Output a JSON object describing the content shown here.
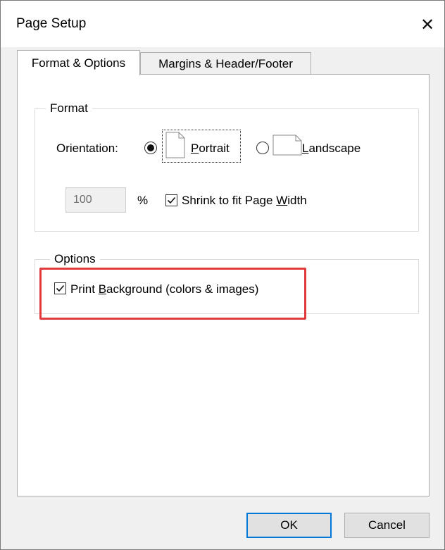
{
  "window": {
    "title": "Page Setup",
    "close_glyph": "✕"
  },
  "tabs": [
    {
      "label": "Format & Options",
      "active": true
    },
    {
      "label": "Margins & Header/Footer",
      "active": false
    }
  ],
  "format": {
    "group_title": "Format",
    "orientation_label": "Orientation:",
    "portrait": {
      "pre": "",
      "accel": "P",
      "post": "ortrait",
      "selected": true
    },
    "landscape": {
      "pre": "",
      "accel": "L",
      "post": "andscape",
      "selected": false
    },
    "scale_value": "100",
    "percent_label": "%",
    "shrink": {
      "pre": "Shrink to fit Page ",
      "accel": "W",
      "post": "idth",
      "checked": true
    }
  },
  "options": {
    "group_title": "Options",
    "print_background": {
      "pre": "Print ",
      "accel": "B",
      "post": "ackground (colors & images)",
      "checked": true
    }
  },
  "buttons": {
    "ok": "OK",
    "cancel": "Cancel"
  },
  "colors": {
    "highlight": "#e0393e",
    "focus_accent": "#0078d7"
  }
}
